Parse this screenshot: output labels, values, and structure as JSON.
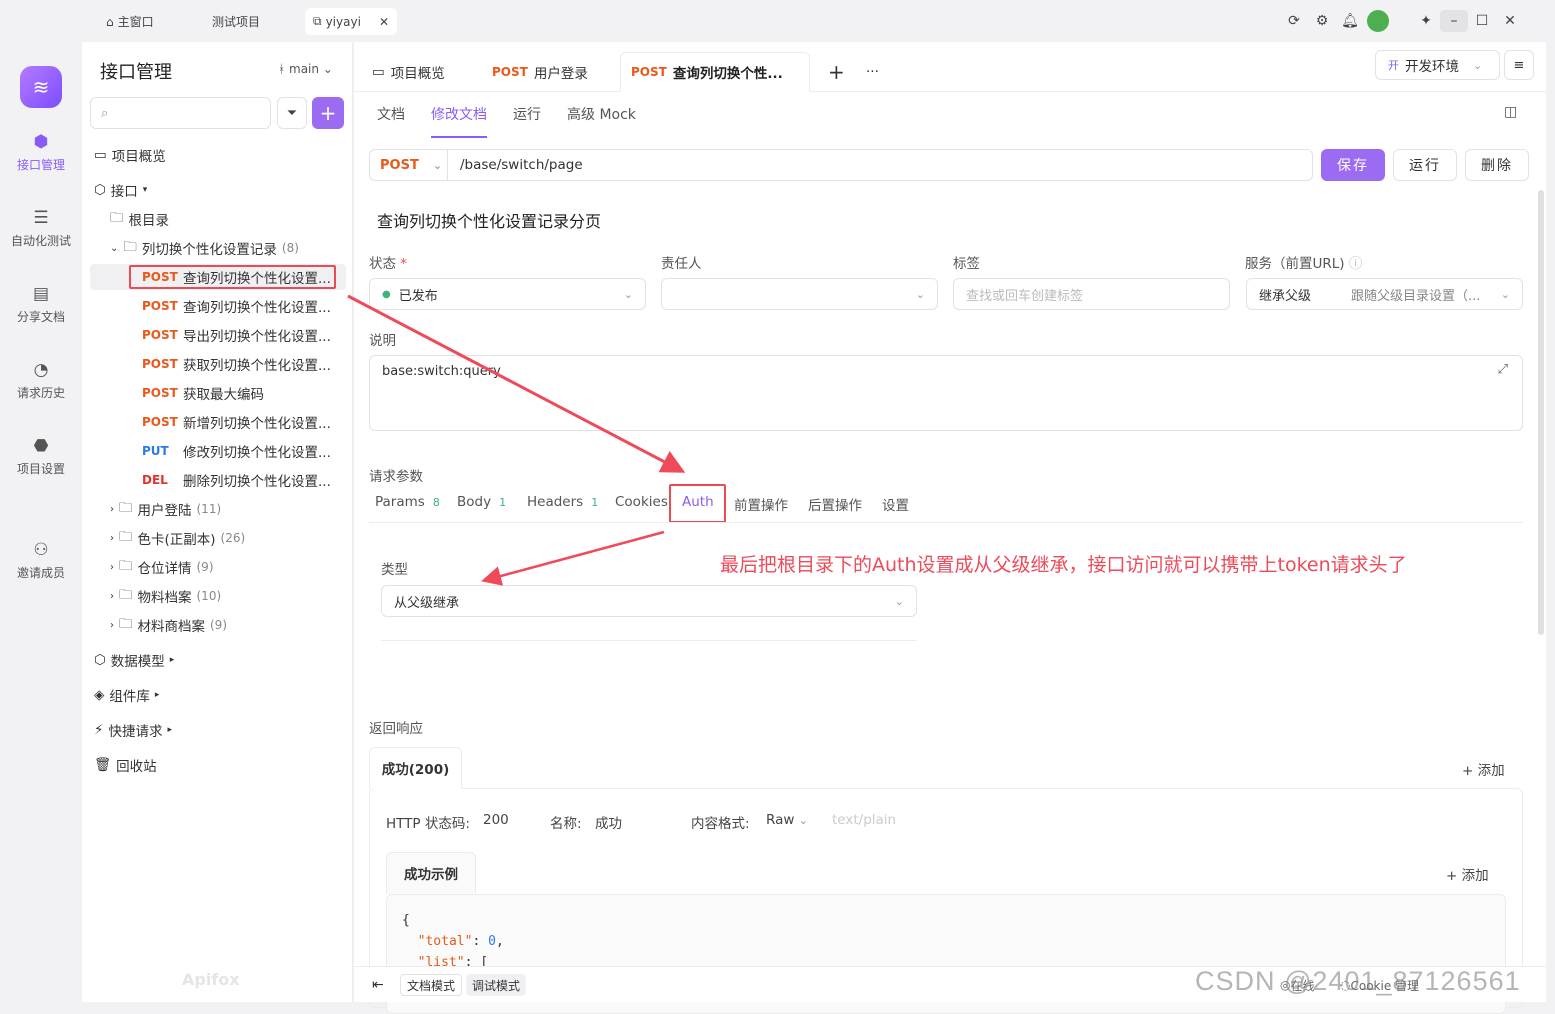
{
  "titlebar": {
    "tabs": [
      {
        "label": "主窗口",
        "icon": "home-icon"
      },
      {
        "label": "测试项目"
      },
      {
        "label": "yiyayi",
        "icon": "external-icon"
      }
    ],
    "close_tab": "✕"
  },
  "rail": {
    "items": [
      {
        "label": "接口管理",
        "icon": "api-icon",
        "active": true
      },
      {
        "label": "自动化测试",
        "icon": "stack-icon"
      },
      {
        "label": "分享文档",
        "icon": "book-icon"
      },
      {
        "label": "请求历史",
        "icon": "clock-icon"
      },
      {
        "label": "项目设置",
        "icon": "settings-icon"
      },
      {
        "label": "邀请成员",
        "icon": "add-user-icon"
      }
    ]
  },
  "sidebar": {
    "title": "接口管理",
    "branch": "main",
    "overview": "项目概览",
    "api_root": "接口",
    "root_dir": "根目录",
    "folder_open": {
      "label": "列切换个性化设置记录",
      "count": "(8)"
    },
    "endpoints": [
      {
        "method": "POST",
        "name": "查询列切换个性化设置..."
      },
      {
        "method": "POST",
        "name": "查询列切换个性化设置..."
      },
      {
        "method": "POST",
        "name": "导出列切换个性化设置..."
      },
      {
        "method": "POST",
        "name": "获取列切换个性化设置..."
      },
      {
        "method": "POST",
        "name": "获取最大编码"
      },
      {
        "method": "POST",
        "name": "新增列切换个性化设置..."
      },
      {
        "method": "PUT",
        "name": "修改列切换个性化设置..."
      },
      {
        "method": "DEL",
        "name": "删除列切换个性化设置..."
      }
    ],
    "folders": [
      {
        "label": "用户登陆",
        "count": "(11)"
      },
      {
        "label": "色卡(正副本)",
        "count": "(26)"
      },
      {
        "label": "仓位详情",
        "count": "(9)"
      },
      {
        "label": "物料档案",
        "count": "(10)"
      },
      {
        "label": "材料商档案",
        "count": "(9)"
      }
    ],
    "sections": [
      "数据模型",
      "组件库",
      "快捷请求",
      "回收站"
    ],
    "brand": "Apifox"
  },
  "main": {
    "tabs": [
      {
        "label": "项目概览"
      },
      {
        "method": "POST",
        "label": "用户登录"
      },
      {
        "method": "POST",
        "label": "查询列切换个性..."
      }
    ],
    "add_tab": "+",
    "more": "···",
    "env": {
      "badge": "开",
      "label": "开发环境"
    },
    "subtabs": [
      "文档",
      "修改文档",
      "运行",
      "高级 Mock"
    ],
    "method": "POST",
    "url": "/base/switch/page",
    "save": "保存",
    "run": "运行",
    "delete": "删除",
    "api_name": "查询列切换个性化设置记录分页",
    "status_label": "状态",
    "status_value": "已发布",
    "owner_label": "责任人",
    "tags_label": "标签",
    "tags_placeholder": "查找或回车创建标签",
    "service_label": "服务（前置URL)",
    "service_value": "继承父级",
    "service_hint": "跟随父级目录设置（...",
    "desc_label": "说明",
    "desc_value": "base:switch:query",
    "params_label": "请求参数",
    "param_tabs": [
      {
        "label": "Params",
        "count": "8"
      },
      {
        "label": "Body",
        "count": "1"
      },
      {
        "label": "Headers",
        "count": "1"
      },
      {
        "label": "Cookies"
      },
      {
        "label": "Auth",
        "active": true
      },
      {
        "label": "前置操作"
      },
      {
        "label": "后置操作"
      },
      {
        "label": "设置"
      }
    ],
    "auth_type_label": "类型",
    "auth_type_value": "从父级继承",
    "annotation": "最后把根目录下的Auth设置成从父级继承，接口访问就可以携带上token请求头了",
    "response_label": "返回响应",
    "response_tab": "成功(200)",
    "add": "+ 添加",
    "http_code_label": "HTTP 状态码:",
    "http_code": "200",
    "name_label": "名称:",
    "name_value": "成功",
    "format_label": "内容格式:",
    "format_value": "Raw",
    "format_hint": "text/plain",
    "example_tab": "成功示例",
    "code_lines": [
      "{",
      "\"total\"",
      "0",
      "\"list\""
    ]
  },
  "bottombar": {
    "doc_mode": "文档模式",
    "debug_mode": "调试模式",
    "online": "在线",
    "cookie": "Cookie 管理"
  },
  "watermark": "CSDN @2401_87126561",
  "colors": {
    "accent": "#8a5cf6",
    "post": "#e8591a",
    "put": "#2c7be5",
    "delete": "#e5322d",
    "annotation": "#ee4a5a"
  }
}
